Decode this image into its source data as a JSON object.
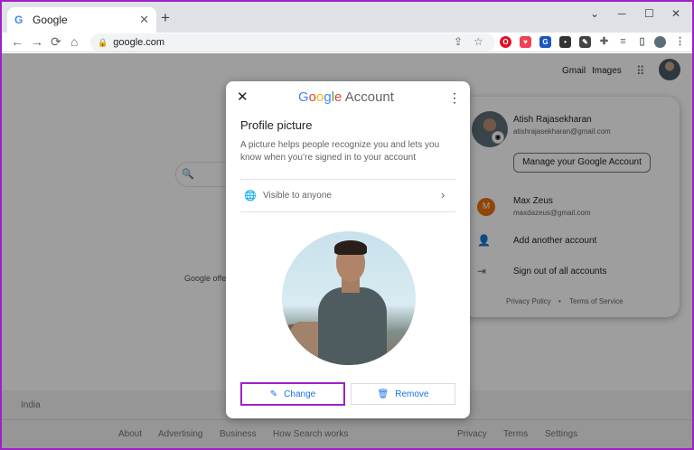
{
  "browser": {
    "tab_title": "Google",
    "tab_favicon": "G",
    "url": "google.com",
    "new_tab": "+",
    "win_minimize": "─",
    "win_maximize": "☐",
    "win_close": "✕"
  },
  "google_page": {
    "top_links": [
      "Gmail",
      "Images"
    ],
    "offered_text": "Google offe",
    "country": "India",
    "footer_left": [
      "About",
      "Advertising",
      "Business",
      "How Search works"
    ],
    "footer_right": [
      "Privacy",
      "Terms",
      "Settings"
    ]
  },
  "account_panel": {
    "primary_name": "Atish Rajasekharan",
    "primary_email": "atishrajasekharan@gmail.com",
    "manage_label": "Manage your Google Account",
    "other_initial": "M",
    "other_name": "Max Zeus",
    "other_email": "maxdazeus@gmail.com",
    "add_account": "Add another account",
    "sign_out": "Sign out of all accounts",
    "privacy_policy": "Privacy Policy",
    "terms": "Terms of Service",
    "separator": "•"
  },
  "dialog": {
    "logo_letters": [
      "G",
      "o",
      "o",
      "g",
      "l",
      "e"
    ],
    "title_suffix": "Account",
    "heading": "Profile picture",
    "description": "A picture helps people recognize you and lets you know when you’re signed in to your account",
    "visibility": "Visible to anyone",
    "change_label": "Change",
    "remove_label": "Remove"
  },
  "colors": {
    "highlight": "#a020c8",
    "link_blue": "#1a73e8",
    "google_blue": "#4285f4",
    "google_red": "#ea4335",
    "google_yellow": "#fbbc05",
    "google_green": "#34a853",
    "account_initial_bg": "#e8710a"
  },
  "icons": {
    "close": "close-icon",
    "more": "more-vert-icon",
    "globe": "globe-icon",
    "chevron": "chevron-right-icon",
    "pencil": "pencil-icon",
    "trash": "trash-icon"
  }
}
